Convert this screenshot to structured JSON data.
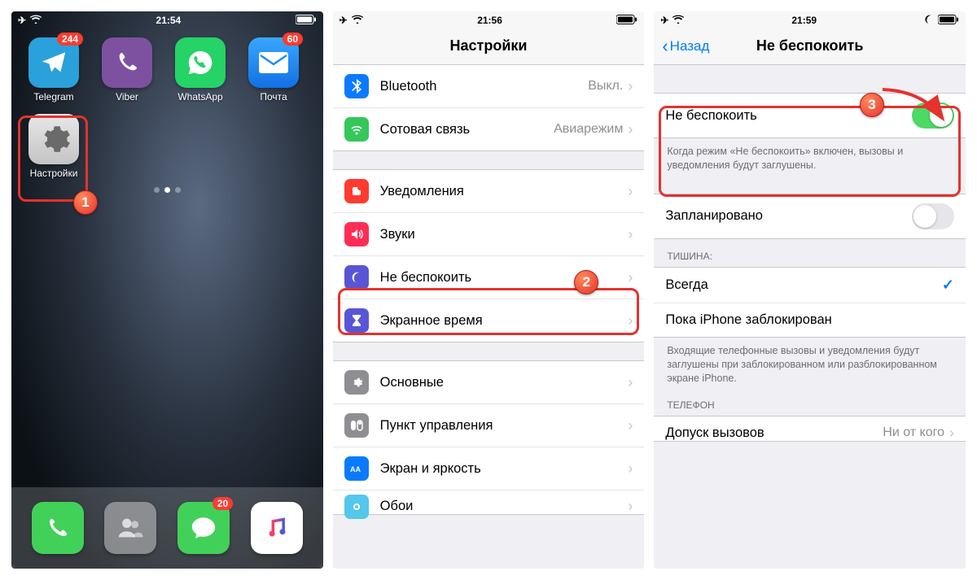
{
  "screen1": {
    "time": "21:54",
    "apps": [
      {
        "name": "Telegram",
        "badge": "244",
        "bg": "#2aa1da",
        "glyph": "telegram"
      },
      {
        "name": "Viber",
        "badge": null,
        "bg": "#7d51a0",
        "glyph": "viber"
      },
      {
        "name": "WhatsApp",
        "badge": null,
        "bg": "#25d366",
        "glyph": "whatsapp"
      },
      {
        "name": "Почта",
        "badge": "60",
        "bg": "#1e8df2",
        "glyph": "mail"
      }
    ],
    "settings_app_label": "Настройки",
    "dock": [
      {
        "name": "phone",
        "bg": "#41d159",
        "badge": null
      },
      {
        "name": "contacts",
        "bg": "rgba(200,200,200,.55)",
        "badge": null
      },
      {
        "name": "messages",
        "bg": "#41d159",
        "badge": "20"
      },
      {
        "name": "music",
        "bg": "#fff",
        "badge": null
      }
    ],
    "step": "1"
  },
  "screen2": {
    "time": "21:56",
    "title": "Настройки",
    "group1": [
      {
        "icon": "bt",
        "ico_bg": "#0a7aff",
        "label": "Bluetooth",
        "value": "Выкл."
      },
      {
        "icon": "cell",
        "ico_bg": "#34c759",
        "label": "Сотовая связь",
        "value": "Авиарежим"
      }
    ],
    "group2": [
      {
        "icon": "notif",
        "ico_bg": "#ff3b30",
        "label": "Уведомления"
      },
      {
        "icon": "sound",
        "ico_bg": "#ff2d55",
        "label": "Звуки"
      },
      {
        "icon": "dnd",
        "ico_bg": "#5856d6",
        "label": "Не беспокоить"
      },
      {
        "icon": "screen",
        "ico_bg": "#5856d6",
        "label": "Экранное время"
      }
    ],
    "group3": [
      {
        "icon": "gear",
        "ico_bg": "#8e8e93",
        "label": "Основные"
      },
      {
        "icon": "cc",
        "ico_bg": "#8e8e93",
        "label": "Пункт управления"
      },
      {
        "icon": "disp",
        "ico_bg": "#0a7aff",
        "label": "Экран и яркость"
      },
      {
        "icon": "wall",
        "ico_bg": "#54c7ec",
        "label": "Обои"
      }
    ],
    "step": "2"
  },
  "screen3": {
    "time": "21:59",
    "back": "Назад",
    "title": "Не беспокоить",
    "dnd_label": "Не беспокоить",
    "dnd_on": true,
    "dnd_footer": "Когда режим «Не беспокоить» включен, вызовы и уведомления будут заглушены.",
    "scheduled_label": "Запланировано",
    "scheduled_on": false,
    "silence_header": "ТИШИНА:",
    "silence_opts": [
      {
        "label": "Всегда",
        "checked": true
      },
      {
        "label": "Пока iPhone заблокирован",
        "checked": false
      }
    ],
    "silence_footer": "Входящие телефонные вызовы и уведомления будут заглушены при заблокированном или разблокированном экране iPhone.",
    "phone_header": "ТЕЛЕФОН",
    "allow_calls_label": "Допуск вызовов",
    "allow_calls_value": "Ни от кого",
    "step": "3"
  }
}
